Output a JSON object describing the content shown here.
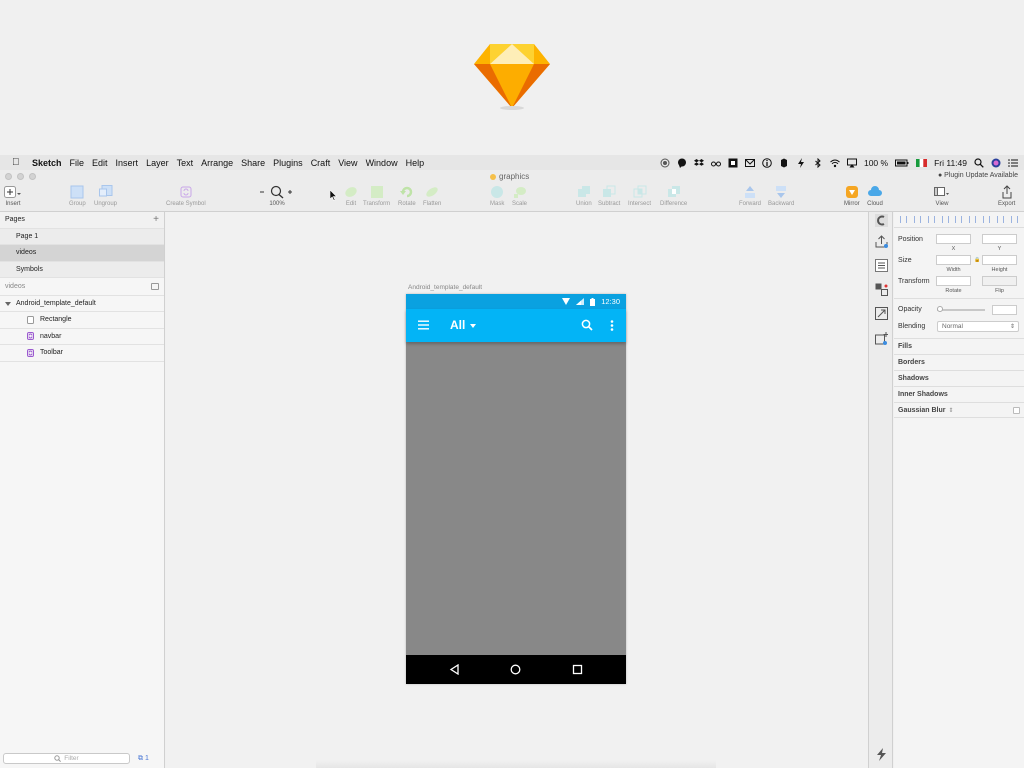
{
  "menubar": {
    "app": "Sketch",
    "items": [
      "File",
      "Edit",
      "Insert",
      "Layer",
      "Text",
      "Arrange",
      "Share",
      "Plugins",
      "Craft",
      "View",
      "Window",
      "Help"
    ],
    "battery": "100 %",
    "clock": "Fri 11:49"
  },
  "window": {
    "doc_title": "graphics",
    "plugin_note": "Plugin Update Available"
  },
  "toolbar": {
    "insert": "Insert",
    "group": "Group",
    "ungroup": "Ungroup",
    "create_symbol": "Create Symbol",
    "zoom": "100%",
    "edit": "Edit",
    "transform": "Transform",
    "rotate": "Rotate",
    "flatten": "Flatten",
    "mask": "Mask",
    "scale": "Scale",
    "union": "Union",
    "subtract": "Subtract",
    "intersect": "Intersect",
    "difference": "Difference",
    "forward": "Forward",
    "backward": "Backward",
    "mirror": "Mirror",
    "cloud": "Cloud",
    "view": "View",
    "export": "Export"
  },
  "pages_panel": {
    "header": "Pages",
    "pages": [
      "Page 1",
      "videos",
      "Symbols"
    ],
    "selected_page": "videos"
  },
  "layers_panel": {
    "section": "videos",
    "artboard": "Android_template_default",
    "layers": [
      "Rectangle",
      "navbar",
      "Toolbar"
    ],
    "filter_placeholder": "Filter",
    "count": "1"
  },
  "canvas": {
    "artboard_label": "Android_template_default",
    "phone": {
      "status_time": "12:30",
      "toolbar_title": "All",
      "colors": {
        "status": "#0aa1e0",
        "toolbar": "#03b4f6",
        "body": "#888888",
        "navbar": "#000000"
      }
    }
  },
  "inspector": {
    "position": "Position",
    "x": "X",
    "y": "Y",
    "size": "Size",
    "width": "Width",
    "height": "Height",
    "transform": "Transform",
    "rotate": "Rotate",
    "flip": "Flip",
    "opacity": "Opacity",
    "blending": "Blending",
    "blending_value": "Normal",
    "sections": [
      "Fills",
      "Borders",
      "Shadows",
      "Inner Shadows",
      "Gaussian Blur"
    ]
  }
}
